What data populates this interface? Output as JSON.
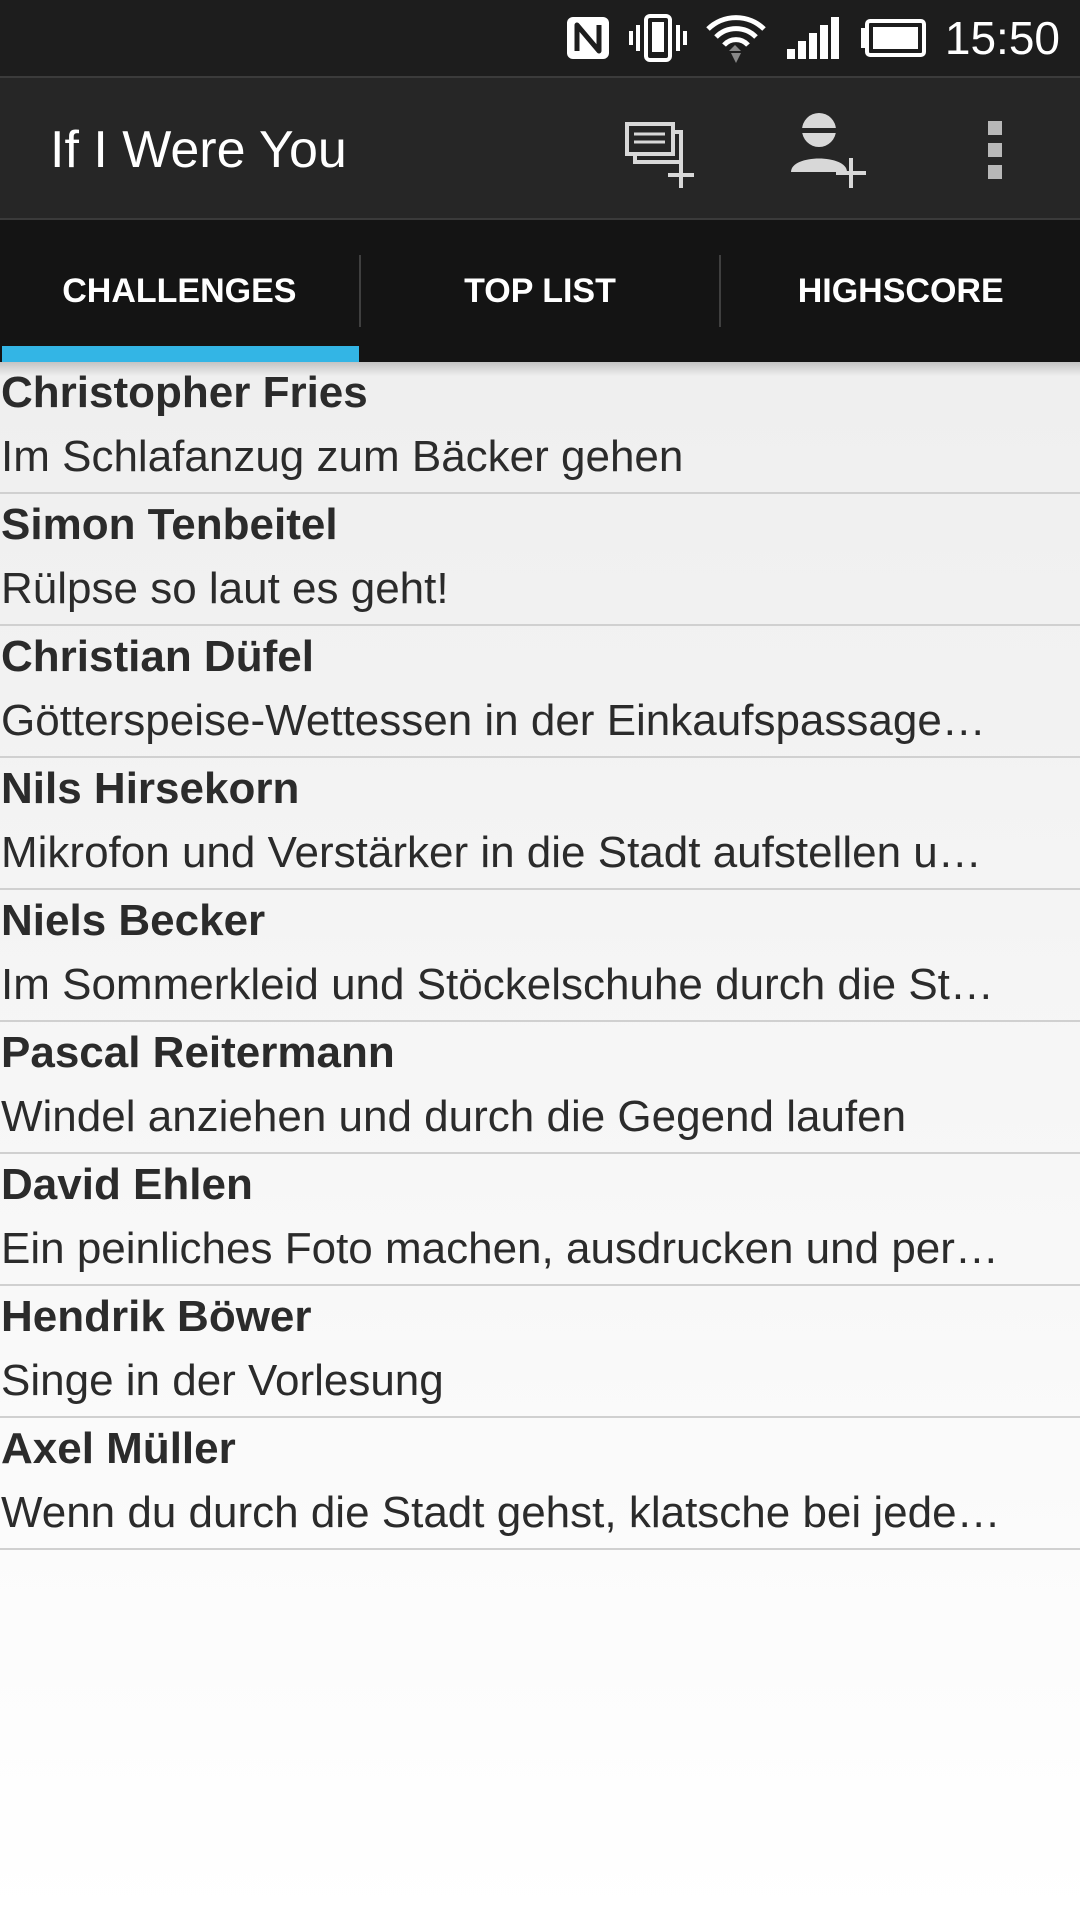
{
  "status_bar": {
    "icons": [
      "nfc-icon",
      "vibrate-icon",
      "wifi-icon",
      "signal-icon",
      "battery-icon"
    ],
    "time": "15:50"
  },
  "action_bar": {
    "title": "If I Were You",
    "actions": [
      {
        "icon": "add-challenge-icon"
      },
      {
        "icon": "add-user-icon"
      },
      {
        "icon": "overflow-menu-icon"
      }
    ]
  },
  "tabs": [
    {
      "label": "CHALLENGES",
      "selected": true
    },
    {
      "label": "TOP LIST",
      "selected": false
    },
    {
      "label": "HIGHSCORE",
      "selected": false
    }
  ],
  "challenges": [
    {
      "name": "Christopher Fries",
      "challenge": "Im Schlafanzug zum Bäcker gehen"
    },
    {
      "name": "Simon Tenbeitel",
      "challenge": "Rülpse so laut es geht!"
    },
    {
      "name": "Christian Düfel",
      "challenge": "Götterspeise-Wettessen in der Einkaufspassage…"
    },
    {
      "name": "Nils Hirsekorn",
      "challenge": "Mikrofon und Verstärker in die Stadt aufstellen u…"
    },
    {
      "name": "Niels Becker",
      "challenge": "Im Sommerkleid und Stöckelschuhe durch die St…"
    },
    {
      "name": "Pascal Reitermann",
      "challenge": "Windel anziehen und durch die Gegend laufen"
    },
    {
      "name": "David Ehlen",
      "challenge": "Ein peinliches Foto machen, ausdrucken und per…"
    },
    {
      "name": "Hendrik Böwer",
      "challenge": "Singe in der Vorlesung"
    },
    {
      "name": "Axel Müller",
      "challenge": "Wenn du durch die Stadt gehst, klatsche bei jede…"
    }
  ],
  "colors": {
    "tab_indicator": "#33b5e5",
    "action_bar": "#262626",
    "status_bar": "#1d1d1d"
  }
}
